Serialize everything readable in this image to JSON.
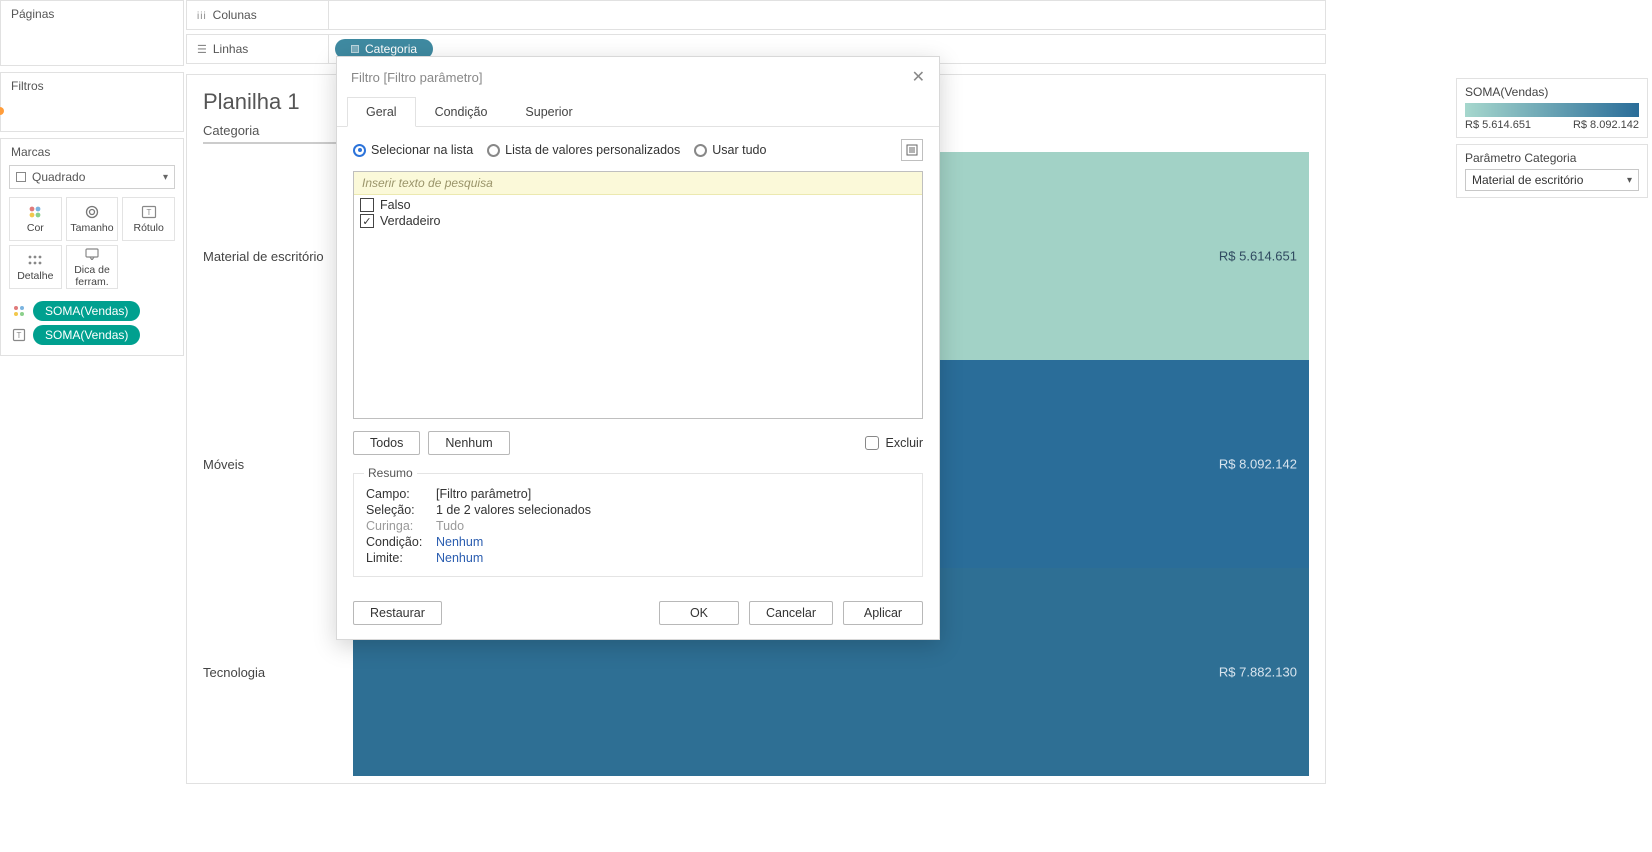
{
  "left": {
    "pages_title": "Páginas",
    "filters_title": "Filtros",
    "marks_title": "Marcas",
    "mark_type": "Quadrado",
    "mark_buttons": {
      "color": "Cor",
      "size": "Tamanho",
      "label": "Rótulo",
      "detail": "Detalhe",
      "tooltip": "Dica de ferram."
    },
    "pills": {
      "color_pill": "SOMA(Vendas)",
      "label_pill": "SOMA(Vendas)"
    }
  },
  "shelves": {
    "columns": "Colunas",
    "rows": "Linhas",
    "row_pill": "Categoria"
  },
  "worksheet": {
    "title": "Planilha 1",
    "axis": "Categoria",
    "rows": [
      {
        "label": "Material de escritório",
        "value": "R$ 5.614.651",
        "color": "#a2d2c6"
      },
      {
        "label": "Móveis",
        "value": "R$ 8.092.142",
        "color": "#2a6d99"
      },
      {
        "label": "Tecnologia",
        "value": "R$ 7.882.130",
        "color": "#2e6f94"
      }
    ]
  },
  "chart_data": {
    "type": "heatmap",
    "title": "Planilha 1",
    "categories": [
      "Material de escritório",
      "Móveis",
      "Tecnologia"
    ],
    "series": [
      {
        "name": "SOMA(Vendas)",
        "values": [
          5614651,
          8092142,
          7882130
        ]
      }
    ],
    "color_scale": {
      "min": 5614651,
      "max": 8092142,
      "field": "SOMA(Vendas)"
    },
    "xlabel": "",
    "ylabel": "Categoria"
  },
  "legend": {
    "title": "SOMA(Vendas)",
    "min": "R$ 5.614.651",
    "max": "R$ 8.092.142"
  },
  "param": {
    "title": "Parâmetro Categoria",
    "value": "Material de escritório"
  },
  "dialog": {
    "title": "Filtro [Filtro parâmetro]",
    "tabs": {
      "general": "Geral",
      "condition": "Condição",
      "top": "Superior"
    },
    "radios": {
      "list": "Selecionar na lista",
      "custom": "Lista de valores personalizados",
      "all": "Usar tudo"
    },
    "search_placeholder": "Inserir texto de pesquisa",
    "items": [
      {
        "label": "Falso",
        "checked": false
      },
      {
        "label": "Verdadeiro",
        "checked": true
      }
    ],
    "btn_all": "Todos",
    "btn_none": "Nenhum",
    "exclude": "Excluir",
    "summary": {
      "legend": "Resumo",
      "field_k": "Campo:",
      "field_v": "[Filtro parâmetro]",
      "selection_k": "Seleção:",
      "selection_v": "1 de 2 valores selecionados",
      "wildcard_k": "Curinga:",
      "wildcard_v": "Tudo",
      "condition_k": "Condição:",
      "condition_v": "Nenhum",
      "limit_k": "Limite:",
      "limit_v": "Nenhum"
    },
    "footer": {
      "reset": "Restaurar",
      "ok": "OK",
      "cancel": "Cancelar",
      "apply": "Aplicar"
    }
  }
}
